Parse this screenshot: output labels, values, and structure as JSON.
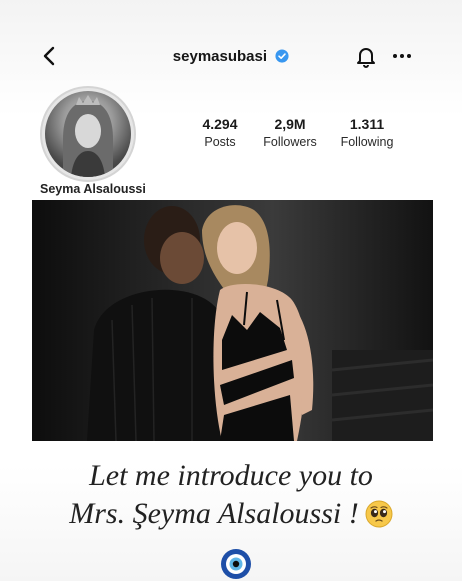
{
  "header": {
    "username": "seymasubasi",
    "icons": {
      "back": "chevron-left-icon",
      "verified": "verified-badge-icon",
      "notifications": "bell-icon",
      "more": "more-horizontal-icon"
    }
  },
  "profile": {
    "display_name": "Seyma Alsaloussi",
    "stats": [
      {
        "value": "4.294",
        "label": "Posts"
      },
      {
        "value": "2,9M",
        "label": "Followers"
      },
      {
        "value": "1.311",
        "label": "Following"
      }
    ]
  },
  "caption": {
    "line1": "Let me introduce you to",
    "line2": "Mrs. Şeyma Alsaloussi !",
    "emojis": [
      "pleading-face-icon",
      "evil-eye-icon"
    ]
  },
  "colors": {
    "verified_blue": "#3897f0",
    "text": "#1a1a1a",
    "evil_eye_blue": "#1e4fa8"
  }
}
